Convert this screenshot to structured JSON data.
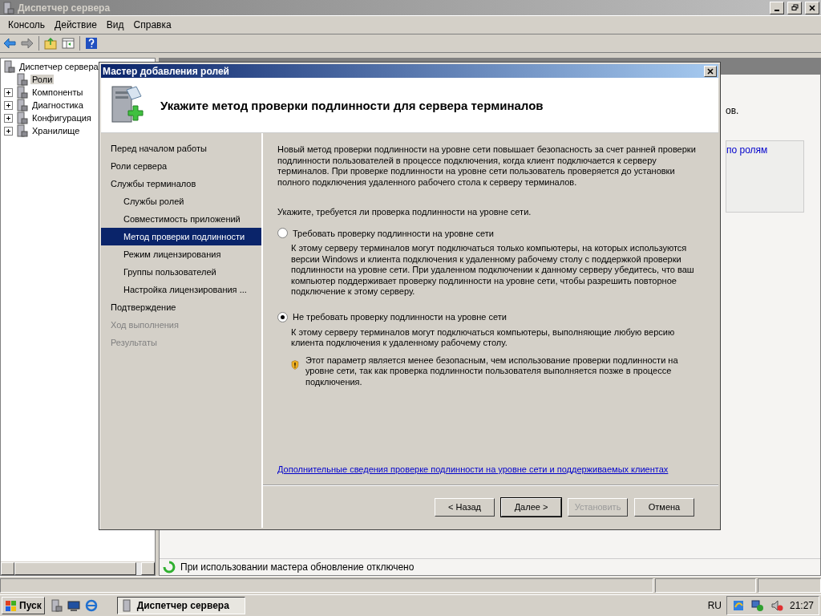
{
  "window": {
    "title": "Диспетчер сервера"
  },
  "menu": [
    "Консоль",
    "Действие",
    "Вид",
    "Справка"
  ],
  "tree": [
    {
      "label": "Диспетчер сервера",
      "selected": false,
      "children": [
        {
          "label": "Роли",
          "kind": "leaf",
          "selected": true
        },
        {
          "label": "Компоненты",
          "kind": "folder",
          "selected": false
        },
        {
          "label": "Диагностика",
          "kind": "folder",
          "selected": false
        },
        {
          "label": "Конфигурация",
          "kind": "folder",
          "selected": false
        },
        {
          "label": "Хранилище",
          "kind": "folder",
          "selected": false
        }
      ]
    }
  ],
  "right_pane": {
    "text_fragment": "ов.",
    "link": "по ролям"
  },
  "status": "При использовании мастера обновление отключено",
  "dialog": {
    "title": "Мастер добавления ролей",
    "heading": "Укажите метод проверки подлинности для сервера терминалов",
    "nav": [
      {
        "label": "Перед началом работы",
        "selected": false,
        "disabled": false
      },
      {
        "label": "Роли сервера",
        "selected": false,
        "disabled": false
      },
      {
        "label": "Службы терминалов",
        "selected": false,
        "disabled": false,
        "children": [
          {
            "label": "Службы ролей",
            "selected": false,
            "disabled": false
          },
          {
            "label": "Совместимость приложений",
            "selected": false,
            "disabled": false
          },
          {
            "label": "Метод проверки подлинности",
            "selected": true,
            "disabled": false
          },
          {
            "label": "Режим лицензирования",
            "selected": false,
            "disabled": false
          },
          {
            "label": "Группы пользователей",
            "selected": false,
            "disabled": false
          },
          {
            "label": "Настройка лицензирования ...",
            "selected": false,
            "disabled": false
          }
        ]
      },
      {
        "label": "Подтверждение",
        "selected": false,
        "disabled": false
      },
      {
        "label": "Ход выполнения",
        "selected": false,
        "disabled": true
      },
      {
        "label": "Результаты",
        "selected": false,
        "disabled": true
      }
    ],
    "intro": "Новый метод проверки подлинности на уровне сети повышает безопасность за счет ранней проверки подлинности пользователей в процессе подключения, когда клиент подключается к серверу терминалов. При проверке подлинности на уровне сети пользователь проверяется до установки полного подключения удаленного рабочего стола к серверу терминалов.",
    "question": "Укажите, требуется ли проверка подлинности на уровне сети.",
    "options": [
      {
        "label": "Требовать проверку подлинности на уровне сети",
        "selected": false,
        "description": "К этому серверу терминалов могут подключаться только компьютеры, на которых используются версии Windows и клиента подключения к удаленному рабочему столу с поддержкой проверки подлинности на уровне сети. При удаленном подключении к данному серверу убедитесь, что ваш компьютер поддерживает проверку подлинности на уровне сети, чтобы разрешить повторное подключение к этому серверу."
      },
      {
        "label": "Не требовать проверку подлинности на уровне сети",
        "selected": true,
        "description": "К этому серверу терминалов могут подключаться компьютеры, выполняющие любую версию клиента подключения к удаленному рабочему столу.",
        "warning": "Этот параметр является менее безопасным, чем использование проверки подлинности на уровне сети, так как проверка подлинности пользователя выполняется позже в процессе подключения."
      }
    ],
    "link": "Дополнительные сведения проверке подлинности на уровне сети и поддерживаемых клиентах",
    "buttons": [
      {
        "label": "< Назад",
        "default": false,
        "disabled": false
      },
      {
        "label": "Далее >",
        "default": true,
        "disabled": false
      },
      {
        "label": "Установить",
        "default": false,
        "disabled": true
      },
      {
        "label": "Отмена",
        "default": false,
        "disabled": false
      }
    ]
  },
  "taskbar": {
    "start": "Пуск",
    "tasks": [
      {
        "label": "Диспетчер сервера",
        "selected": true
      }
    ],
    "language": "RU",
    "clock": "21:27"
  }
}
